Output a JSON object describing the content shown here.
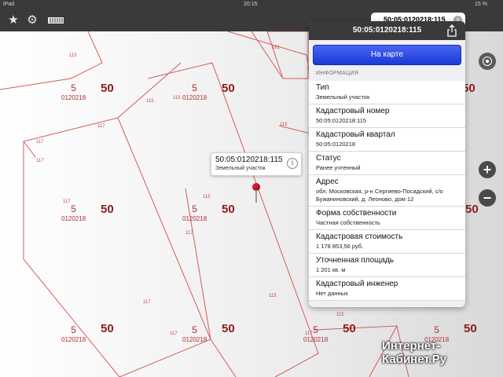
{
  "status": {
    "carrier": "iPad",
    "time": "20:15",
    "battery": "15 %"
  },
  "search": {
    "value": "50:05:0120218:115"
  },
  "map": {
    "plots": [
      {
        "n": "5",
        "q": "0120218"
      },
      {
        "n": "5",
        "q": "0120218"
      },
      {
        "n": "5",
        "q": "0120218"
      },
      {
        "n": "5",
        "q": "0120218"
      },
      {
        "n": "5",
        "q": "0120218"
      },
      {
        "n": "5",
        "q": "0120218"
      },
      {
        "n": "5",
        "q": "0120218"
      },
      {
        "n": "5",
        "q": "0120218"
      }
    ],
    "big": [
      "50",
      "50",
      "50",
      "50",
      "50",
      "50",
      "50",
      "50",
      "50",
      "50"
    ],
    "small": [
      "113",
      "115",
      "115",
      "117",
      "117",
      "117",
      "117",
      "115",
      "117",
      "117",
      "115",
      "117",
      "117",
      "115",
      "161",
      "115"
    ],
    "callout": {
      "title": "50:05:0120218:115",
      "subtitle": "Земельный участок"
    }
  },
  "panel": {
    "title": "50:05:0120218:115",
    "on_map": "На карте",
    "section": "ИНФОРМАЦИЯ",
    "rows": [
      {
        "title": "Тип",
        "value": "Земельный участок"
      },
      {
        "title": "Кадастровый номер",
        "value": "50:05:0120218:115"
      },
      {
        "title": "Кадастровый квартал",
        "value": "50:05:0120218"
      },
      {
        "title": "Статус",
        "value": "Ранее учтенный"
      },
      {
        "title": "Адрес",
        "value": "обл. Московская, р-н Сергиево-Посадский, с/о Бужаниновский, д. Леоново, дом 12"
      },
      {
        "title": "Форма собственности",
        "value": "Частная собственность"
      },
      {
        "title": "Кадастровая стоимость",
        "value": "1 178 853,56 руб."
      },
      {
        "title": "Уточненная площадь",
        "value": "1 201 кв. м"
      },
      {
        "title": "Кадастровый инженер",
        "value": "Нет данных"
      }
    ]
  },
  "watermark": {
    "line1": "Интернет-",
    "line2": "Кабинет.Ру"
  }
}
